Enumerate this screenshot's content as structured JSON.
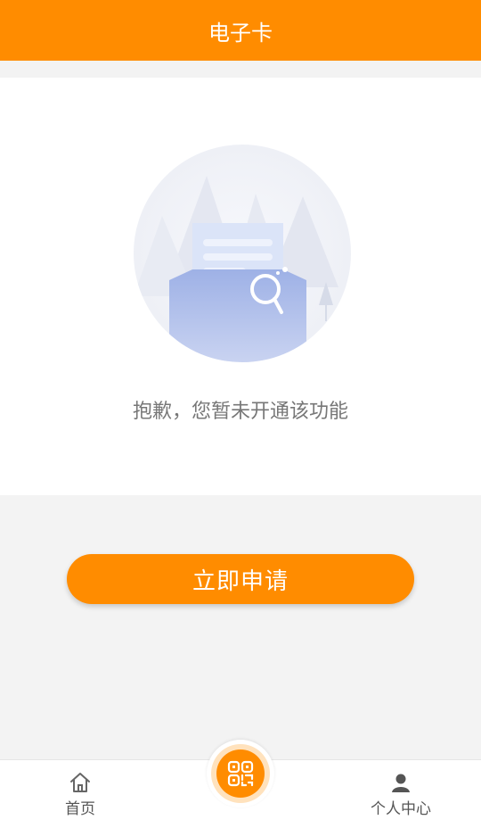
{
  "header": {
    "title": "电子卡"
  },
  "empty_state": {
    "illustration": "empty-document-search-illustration",
    "message": "抱歉，您暂未开通该功能"
  },
  "actions": {
    "apply_label": "立即申请"
  },
  "tabbar": {
    "items": [
      {
        "label": "首页",
        "icon": "home-icon"
      },
      {
        "label": "",
        "icon": "qr-code-icon"
      },
      {
        "label": "个人中心",
        "icon": "person-icon"
      }
    ]
  },
  "colors": {
    "accent": "#ff8c00",
    "background": "#f3f3f3",
    "text_muted": "#777777"
  }
}
